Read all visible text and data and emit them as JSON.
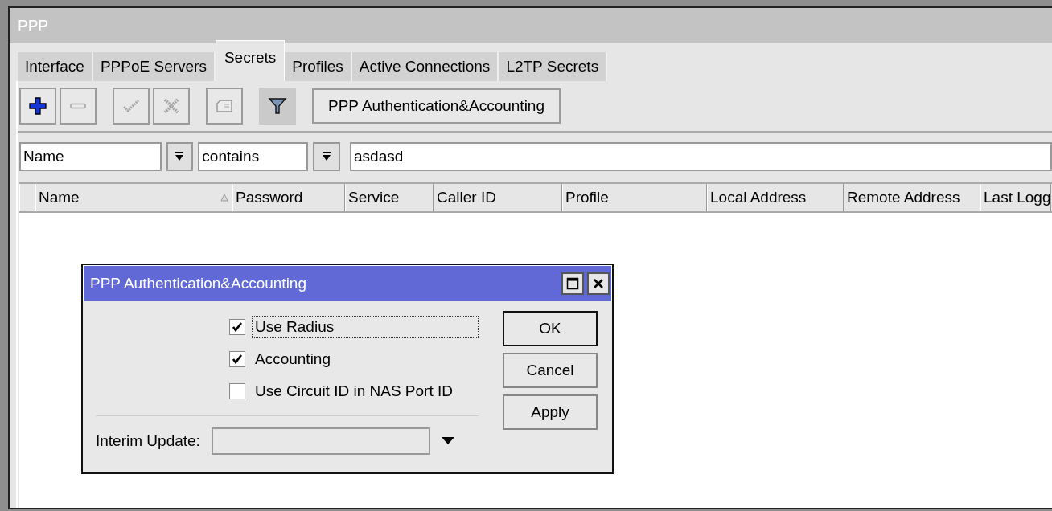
{
  "window": {
    "title": "PPP"
  },
  "tabs": [
    {
      "label": "Interface",
      "selected": false
    },
    {
      "label": "PPPoE Servers",
      "selected": false
    },
    {
      "label": "Secrets",
      "selected": true
    },
    {
      "label": "Profiles",
      "selected": false
    },
    {
      "label": "Active Connections",
      "selected": false
    },
    {
      "label": "L2TP Secrets",
      "selected": false
    }
  ],
  "toolbar": {
    "buttons": [
      {
        "kind": "add",
        "disabled": false,
        "active": false
      },
      {
        "kind": "remove",
        "disabled": true,
        "active": false
      },
      {
        "kind": "enable",
        "disabled": true,
        "active": false
      },
      {
        "kind": "disable",
        "disabled": true,
        "active": false
      },
      {
        "kind": "comment",
        "disabled": true,
        "active": false
      },
      {
        "kind": "filter",
        "disabled": false,
        "active": true
      }
    ],
    "auth_button": "PPP Authentication&Accounting"
  },
  "filter": {
    "field": "Name",
    "operator": "contains",
    "value": "asdasd"
  },
  "table": {
    "columns": [
      {
        "label": "Name",
        "sorted": true
      },
      {
        "label": "Password",
        "sorted": false
      },
      {
        "label": "Service",
        "sorted": false
      },
      {
        "label": "Caller ID",
        "sorted": false
      },
      {
        "label": "Profile",
        "sorted": false
      },
      {
        "label": "Local Address",
        "sorted": false
      },
      {
        "label": "Remote Address",
        "sorted": false
      },
      {
        "label": "Last Logg",
        "sorted": false
      }
    ]
  },
  "dialog": {
    "title": "PPP Authentication&Accounting",
    "options": [
      {
        "label": "Use Radius",
        "checked": true,
        "focused": true
      },
      {
        "label": "Accounting",
        "checked": true,
        "focused": false
      },
      {
        "label": "Use Circuit ID in NAS Port ID",
        "checked": false,
        "focused": false
      }
    ],
    "interim_update": {
      "label": "Interim Update:",
      "disabled": true
    },
    "buttons": [
      {
        "label": "OK",
        "default": true
      },
      {
        "label": "Cancel",
        "default": false
      },
      {
        "label": "Apply",
        "default": false
      }
    ]
  }
}
